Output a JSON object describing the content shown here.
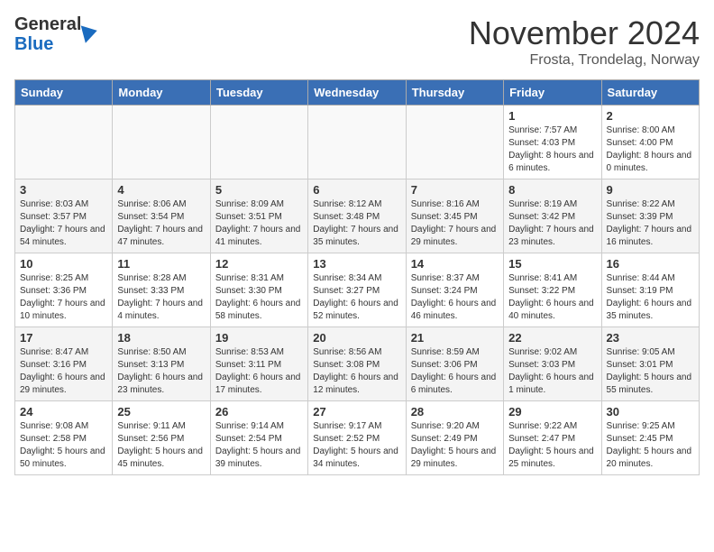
{
  "logo": {
    "general": "General",
    "blue": "Blue"
  },
  "title": {
    "month": "November 2024",
    "location": "Frosta, Trondelag, Norway"
  },
  "headers": [
    "Sunday",
    "Monday",
    "Tuesday",
    "Wednesday",
    "Thursday",
    "Friday",
    "Saturday"
  ],
  "weeks": [
    [
      {
        "day": "",
        "info": ""
      },
      {
        "day": "",
        "info": ""
      },
      {
        "day": "",
        "info": ""
      },
      {
        "day": "",
        "info": ""
      },
      {
        "day": "",
        "info": ""
      },
      {
        "day": "1",
        "info": "Sunrise: 7:57 AM\nSunset: 4:03 PM\nDaylight: 8 hours and 6 minutes."
      },
      {
        "day": "2",
        "info": "Sunrise: 8:00 AM\nSunset: 4:00 PM\nDaylight: 8 hours and 0 minutes."
      }
    ],
    [
      {
        "day": "3",
        "info": "Sunrise: 8:03 AM\nSunset: 3:57 PM\nDaylight: 7 hours and 54 minutes."
      },
      {
        "day": "4",
        "info": "Sunrise: 8:06 AM\nSunset: 3:54 PM\nDaylight: 7 hours and 47 minutes."
      },
      {
        "day": "5",
        "info": "Sunrise: 8:09 AM\nSunset: 3:51 PM\nDaylight: 7 hours and 41 minutes."
      },
      {
        "day": "6",
        "info": "Sunrise: 8:12 AM\nSunset: 3:48 PM\nDaylight: 7 hours and 35 minutes."
      },
      {
        "day": "7",
        "info": "Sunrise: 8:16 AM\nSunset: 3:45 PM\nDaylight: 7 hours and 29 minutes."
      },
      {
        "day": "8",
        "info": "Sunrise: 8:19 AM\nSunset: 3:42 PM\nDaylight: 7 hours and 23 minutes."
      },
      {
        "day": "9",
        "info": "Sunrise: 8:22 AM\nSunset: 3:39 PM\nDaylight: 7 hours and 16 minutes."
      }
    ],
    [
      {
        "day": "10",
        "info": "Sunrise: 8:25 AM\nSunset: 3:36 PM\nDaylight: 7 hours and 10 minutes."
      },
      {
        "day": "11",
        "info": "Sunrise: 8:28 AM\nSunset: 3:33 PM\nDaylight: 7 hours and 4 minutes."
      },
      {
        "day": "12",
        "info": "Sunrise: 8:31 AM\nSunset: 3:30 PM\nDaylight: 6 hours and 58 minutes."
      },
      {
        "day": "13",
        "info": "Sunrise: 8:34 AM\nSunset: 3:27 PM\nDaylight: 6 hours and 52 minutes."
      },
      {
        "day": "14",
        "info": "Sunrise: 8:37 AM\nSunset: 3:24 PM\nDaylight: 6 hours and 46 minutes."
      },
      {
        "day": "15",
        "info": "Sunrise: 8:41 AM\nSunset: 3:22 PM\nDaylight: 6 hours and 40 minutes."
      },
      {
        "day": "16",
        "info": "Sunrise: 8:44 AM\nSunset: 3:19 PM\nDaylight: 6 hours and 35 minutes."
      }
    ],
    [
      {
        "day": "17",
        "info": "Sunrise: 8:47 AM\nSunset: 3:16 PM\nDaylight: 6 hours and 29 minutes."
      },
      {
        "day": "18",
        "info": "Sunrise: 8:50 AM\nSunset: 3:13 PM\nDaylight: 6 hours and 23 minutes."
      },
      {
        "day": "19",
        "info": "Sunrise: 8:53 AM\nSunset: 3:11 PM\nDaylight: 6 hours and 17 minutes."
      },
      {
        "day": "20",
        "info": "Sunrise: 8:56 AM\nSunset: 3:08 PM\nDaylight: 6 hours and 12 minutes."
      },
      {
        "day": "21",
        "info": "Sunrise: 8:59 AM\nSunset: 3:06 PM\nDaylight: 6 hours and 6 minutes."
      },
      {
        "day": "22",
        "info": "Sunrise: 9:02 AM\nSunset: 3:03 PM\nDaylight: 6 hours and 1 minute."
      },
      {
        "day": "23",
        "info": "Sunrise: 9:05 AM\nSunset: 3:01 PM\nDaylight: 5 hours and 55 minutes."
      }
    ],
    [
      {
        "day": "24",
        "info": "Sunrise: 9:08 AM\nSunset: 2:58 PM\nDaylight: 5 hours and 50 minutes."
      },
      {
        "day": "25",
        "info": "Sunrise: 9:11 AM\nSunset: 2:56 PM\nDaylight: 5 hours and 45 minutes."
      },
      {
        "day": "26",
        "info": "Sunrise: 9:14 AM\nSunset: 2:54 PM\nDaylight: 5 hours and 39 minutes."
      },
      {
        "day": "27",
        "info": "Sunrise: 9:17 AM\nSunset: 2:52 PM\nDaylight: 5 hours and 34 minutes."
      },
      {
        "day": "28",
        "info": "Sunrise: 9:20 AM\nSunset: 2:49 PM\nDaylight: 5 hours and 29 minutes."
      },
      {
        "day": "29",
        "info": "Sunrise: 9:22 AM\nSunset: 2:47 PM\nDaylight: 5 hours and 25 minutes."
      },
      {
        "day": "30",
        "info": "Sunrise: 9:25 AM\nSunset: 2:45 PM\nDaylight: 5 hours and 20 minutes."
      }
    ]
  ]
}
